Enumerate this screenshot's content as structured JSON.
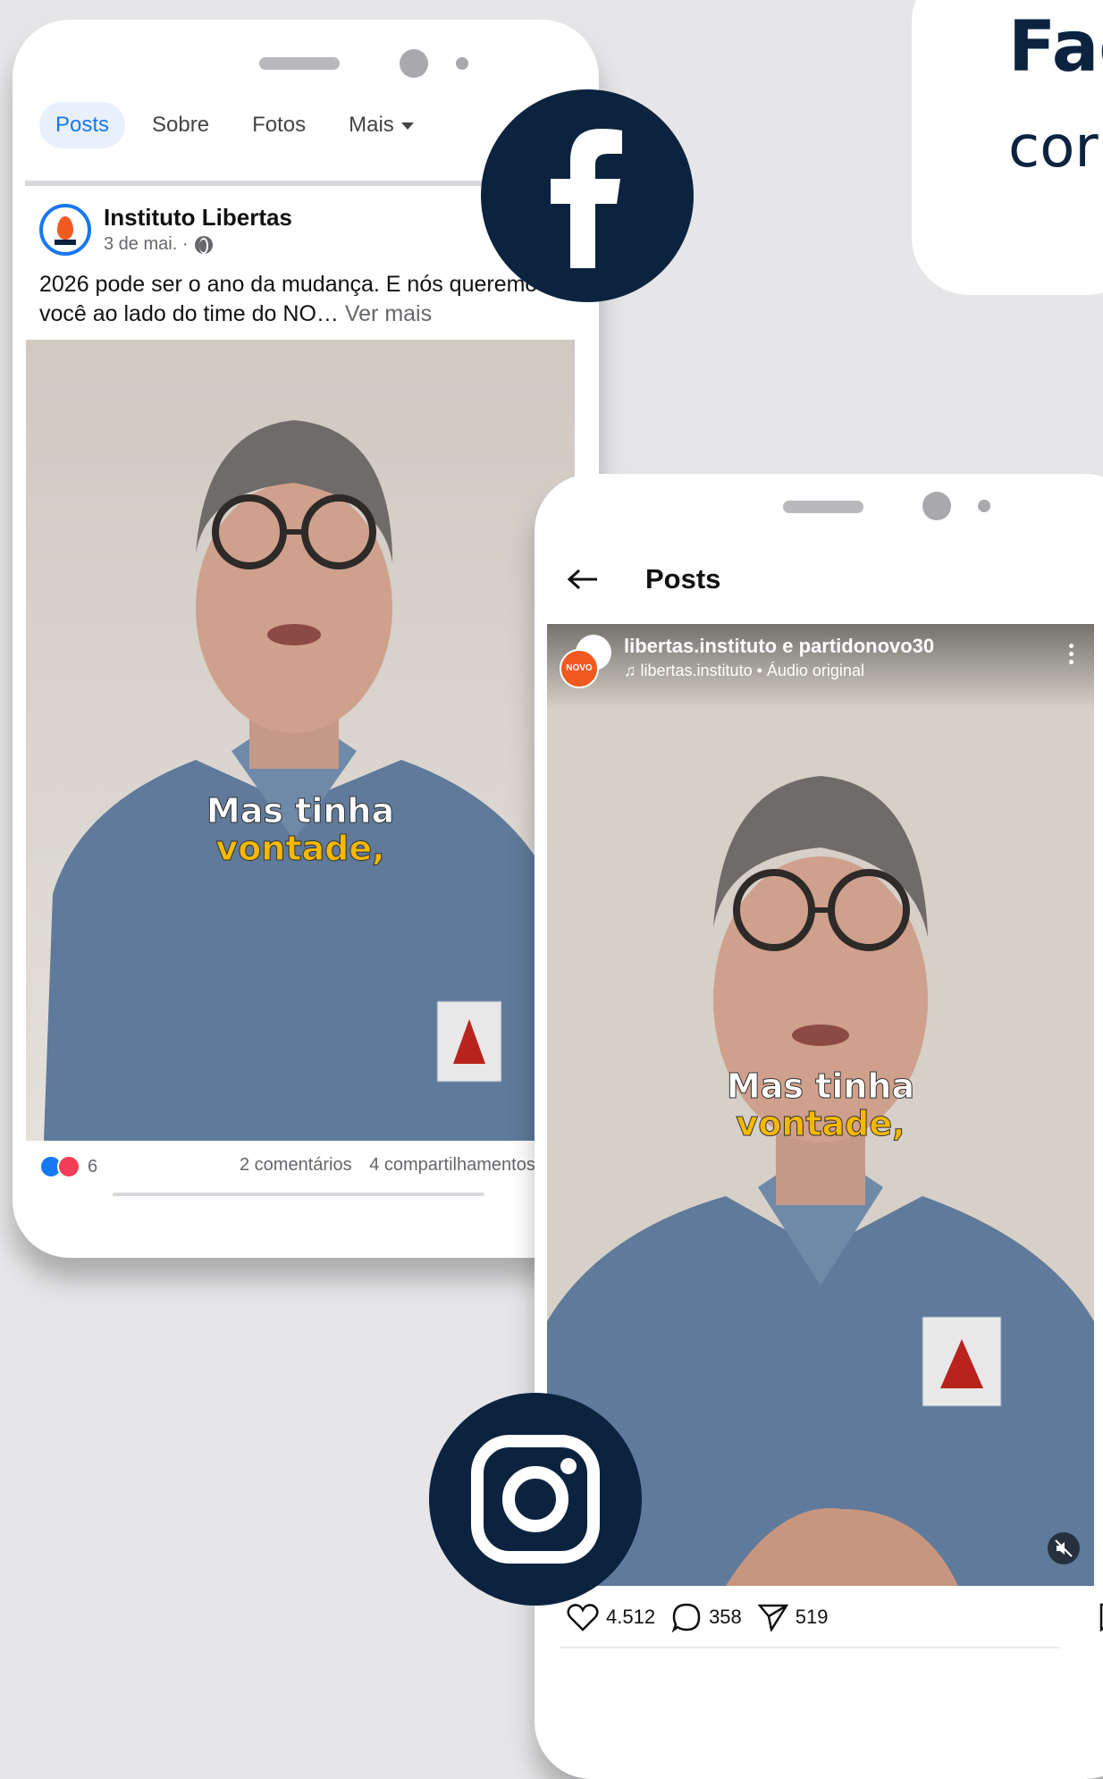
{
  "promo": {
    "title": "Fac",
    "subtitle": "cor"
  },
  "facebook": {
    "tabs": [
      "Posts",
      "Sobre",
      "Fotos",
      "Mais"
    ],
    "page_name": "Instituto Libertas",
    "date": "3 de mai. ·",
    "post_text": "2026 pode ser o ano da mudança. E nós queremos você ao lado do time do NO…",
    "see_more": "Ver mais",
    "caption_line1": "Mas tinha",
    "caption_line2": "vontade,",
    "reaction_count": "6",
    "comments": "2 comentários",
    "shares": "4 compartilhamentos"
  },
  "instagram": {
    "title": "Posts",
    "user": "libertas.instituto e partidonovo30",
    "audio": "libertas.instituto • Áudio original",
    "avatar_badge": "NOVO",
    "caption_line1": "Mas tinha",
    "caption_line2": "vontade,",
    "likes": "4.512",
    "comments": "358",
    "shares": "519"
  },
  "colors": {
    "navy": "#0c2340",
    "fb_blue": "#1877f2",
    "caption_yellow": "#f5b800",
    "shirt_blue": "#5f7a9a"
  },
  "icons": [
    "facebook-logo-icon",
    "instagram-logo-icon",
    "globe-icon",
    "heart-icon",
    "comment-icon",
    "send-icon",
    "bookmark-icon",
    "back-arrow-icon",
    "mute-icon"
  ]
}
